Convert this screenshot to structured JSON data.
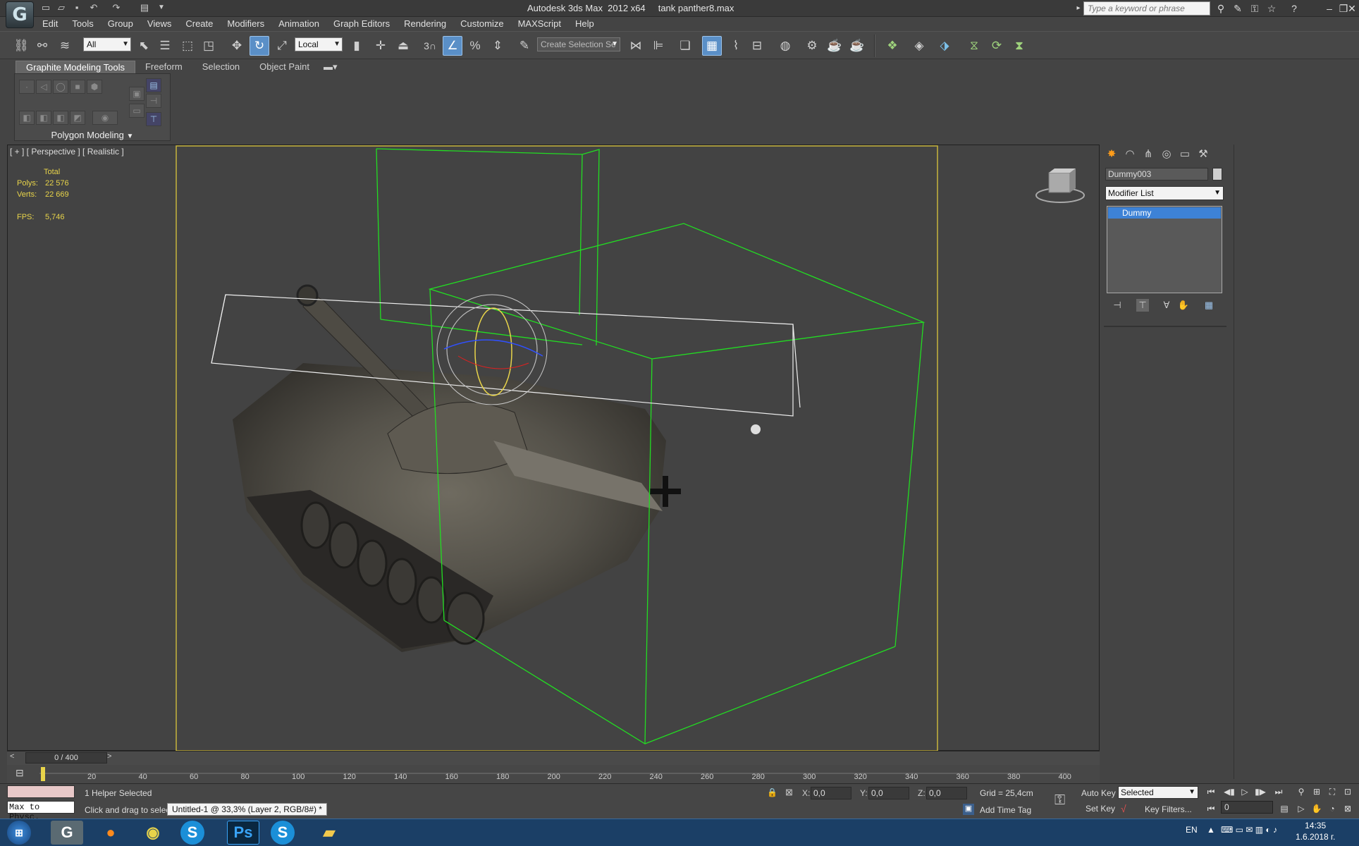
{
  "window": {
    "title": "Autodesk 3ds Max  2012 x64     tank panther8.max",
    "search_placeholder": "Type a keyword or phrase"
  },
  "menu": [
    "Edit",
    "Tools",
    "Group",
    "Views",
    "Create",
    "Modifiers",
    "Animation",
    "Graph Editors",
    "Rendering",
    "Customize",
    "MAXScript",
    "Help"
  ],
  "toolbar": {
    "selection_filter": "All",
    "reference_coord": "Local",
    "snap_angle": "3",
    "named_selection": "Create Selection Se"
  },
  "ribbon": {
    "tabs": [
      "Graphite Modeling Tools",
      "Freeform",
      "Selection",
      "Object Paint"
    ],
    "panel_label": "Polygon Modeling"
  },
  "viewport": {
    "label": "[ + ] [ Perspective ] [ Realistic ]",
    "stats": {
      "header": "Total",
      "polys_label": "Polys:",
      "polys": "22 576",
      "verts_label": "Verts:",
      "verts": "22 669",
      "fps_label": "FPS:",
      "fps": "5,746"
    }
  },
  "command_panel": {
    "object_name": "Dummy003",
    "modifier_list": "Modifier List",
    "stack_item": "Dummy"
  },
  "timeline": {
    "frame": "0 / 400",
    "ticks": [
      "20",
      "40",
      "60",
      "80",
      "100",
      "120",
      "140",
      "160",
      "180",
      "200",
      "220",
      "240",
      "260",
      "280",
      "300",
      "320",
      "340",
      "360",
      "380",
      "400"
    ]
  },
  "status": {
    "maxscript_label": "Max to Physc.",
    "selection": "1 Helper Selected",
    "prompt": "Click and drag to select a",
    "tooltip": "Untitled-1 @ 33,3% (Layer 2, RGB/8#) *",
    "x_label": "X:",
    "x": "0,0",
    "y_label": "Y:",
    "y": "0,0",
    "z_label": "Z:",
    "z": "0,0",
    "grid": "Grid = 25,4cm",
    "add_time_tag": "Add Time Tag",
    "auto_key": "Auto Key",
    "set_key": "Set Key",
    "key_mode": "Selected",
    "key_filters": "Key Filters...",
    "current_frame": "0"
  },
  "taskbar": {
    "lang": "EN",
    "time": "14:35",
    "date": "1.6.2018 г."
  }
}
